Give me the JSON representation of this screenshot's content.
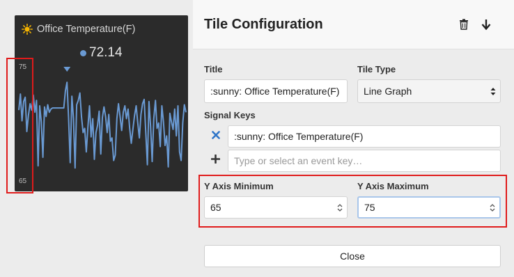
{
  "tile": {
    "icon": "sun-icon",
    "title": "Office Temperature(F)",
    "value": "72.14",
    "y_max_label": "75",
    "y_min_label": "65"
  },
  "chart_data": {
    "type": "line",
    "ylim": [
      65,
      75
    ],
    "series_color": "#6a9ad3",
    "ytick_labels": [
      "75",
      "65"
    ],
    "y": [
      72,
      73.5,
      71,
      72.8,
      73.2,
      70,
      71.5,
      72.6,
      72,
      73.4,
      71.8,
      72.9,
      66.8,
      72.4,
      70.9,
      67.6,
      72.3,
      71.4,
      72.5,
      71.8,
      72.1,
      72.2,
      72.2,
      72.2,
      72.2,
      72.2,
      72.2,
      72.2,
      72.2,
      73.8,
      74.6,
      71.2,
      67.1,
      73.3,
      71.2,
      66.6,
      72.5,
      72.9,
      73.6,
      71.4,
      69.9,
      70.3,
      68.1,
      70.4,
      72.4,
      69.5,
      71.2,
      67.4,
      69.9,
      70.6,
      71.9,
      67.9,
      71.3,
      72.3,
      71.4,
      69.9,
      71.6,
      69.1,
      69.4,
      67.3,
      67.8,
      71.2,
      72.6,
      71.4,
      70.1,
      71.8,
      72.4,
      71.2,
      72.1,
      70.3,
      68.9,
      70.2,
      71.5,
      72.4,
      70.8,
      69.4,
      71.6,
      72.6,
      73.0,
      69.9,
      66.9,
      72.8,
      70.5,
      67.2,
      71.2,
      72.9,
      70.3,
      70.8,
      68.6,
      72.4,
      70.9,
      68.7,
      69.6,
      66.7,
      71.7,
      70.9,
      70.2,
      72.1,
      69.6,
      72.4,
      68.1,
      67.3,
      70.8,
      72.5,
      71.8
    ]
  },
  "panel": {
    "title": "Tile Configuration",
    "delete_icon": "trash-icon",
    "move_icon": "arrow-down-icon",
    "title_label": "Title",
    "title_value": ":sunny: Office Temperature(F)",
    "tile_type_label": "Tile Type",
    "tile_type_value": "Line Graph",
    "signal_keys_label": "Signal Keys",
    "signal_key_1": ":sunny: Office Temperature(F)",
    "signal_key_placeholder": "Type or select an event key…",
    "remove_icon": "close-x-icon",
    "add_icon": "plus-icon",
    "y_min_label": "Y Axis Minimum",
    "y_min_value": "65",
    "y_max_label": "Y Axis Maximum",
    "y_max_value": "75",
    "close_label": "Close"
  },
  "colors": {
    "accent": "#6a9ad3",
    "highlight": "#e01b1b",
    "tile_bg": "#2b2b2b"
  }
}
